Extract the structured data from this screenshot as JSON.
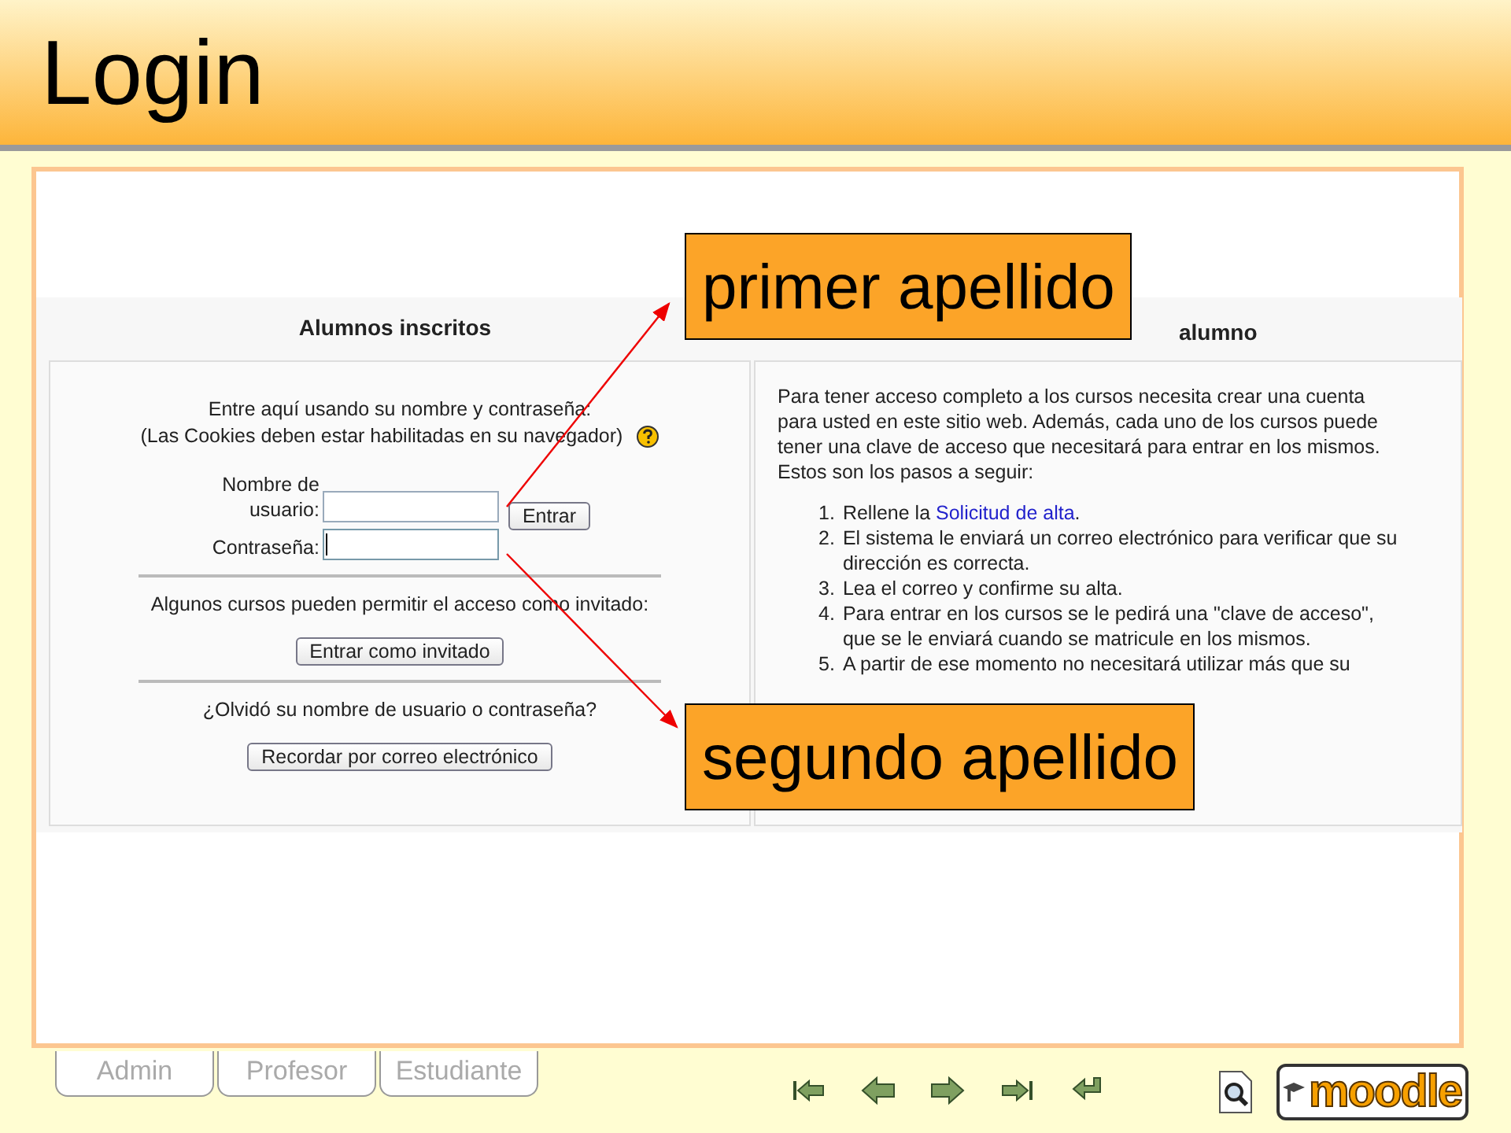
{
  "slide": {
    "title": "Login"
  },
  "login_page": {
    "left": {
      "heading": "Alumnos inscritos",
      "intro": [
        "Entre aquí usando su nombre y contraseña:",
        "(Las Cookies deben estar habilitadas en su navegador)"
      ],
      "fields": [
        {
          "label": "Nombre de usuario:",
          "focused": false
        },
        {
          "label": "Contraseña:",
          "focused": true
        }
      ],
      "submit": "Entrar",
      "guest_text": "Algunos cursos pueden permitir el acceso como invitado:",
      "guest_button": "Entrar como invitado",
      "forgot_text": "¿Olvidó su nombre de usuario o contraseña?",
      "forgot_button": "Recordar por correo electrónico"
    },
    "right": {
      "heading": "alumno",
      "intro": "Para tener acceso completo a los cursos necesita crear una cuenta para usted en este sitio web. Además, cada uno de los cursos puede tener una clave de acceso que necesitará para entrar en los mismos. Estos son los pasos a seguir:",
      "steps": [
        {
          "number": "1.",
          "text": "Rellene la ",
          "link": "Solicitud de alta",
          "after": "."
        },
        {
          "number": "2.",
          "text": "El sistema le enviará un correo electrónico para verificar que su dirección es correcta."
        },
        {
          "number": "3.",
          "text": "Lea el correo y confirme su alta."
        },
        {
          "number": "4.",
          "text": "Para entrar en los cursos se le pedirá una \"clave de acceso\", que se le enviará cuando se matricule en los mismos."
        },
        {
          "number": "5.",
          "text": "A partir de ese momento no necesitará utilizar más que su"
        }
      ]
    }
  },
  "callouts": [
    {
      "text": "primer apellido"
    },
    {
      "text": "segundo apellido"
    }
  ],
  "footer": {
    "tabs": [
      {
        "label": "Admin"
      },
      {
        "label": "Profesor"
      },
      {
        "label": "Estudiante"
      }
    ],
    "logo": "moodle"
  }
}
